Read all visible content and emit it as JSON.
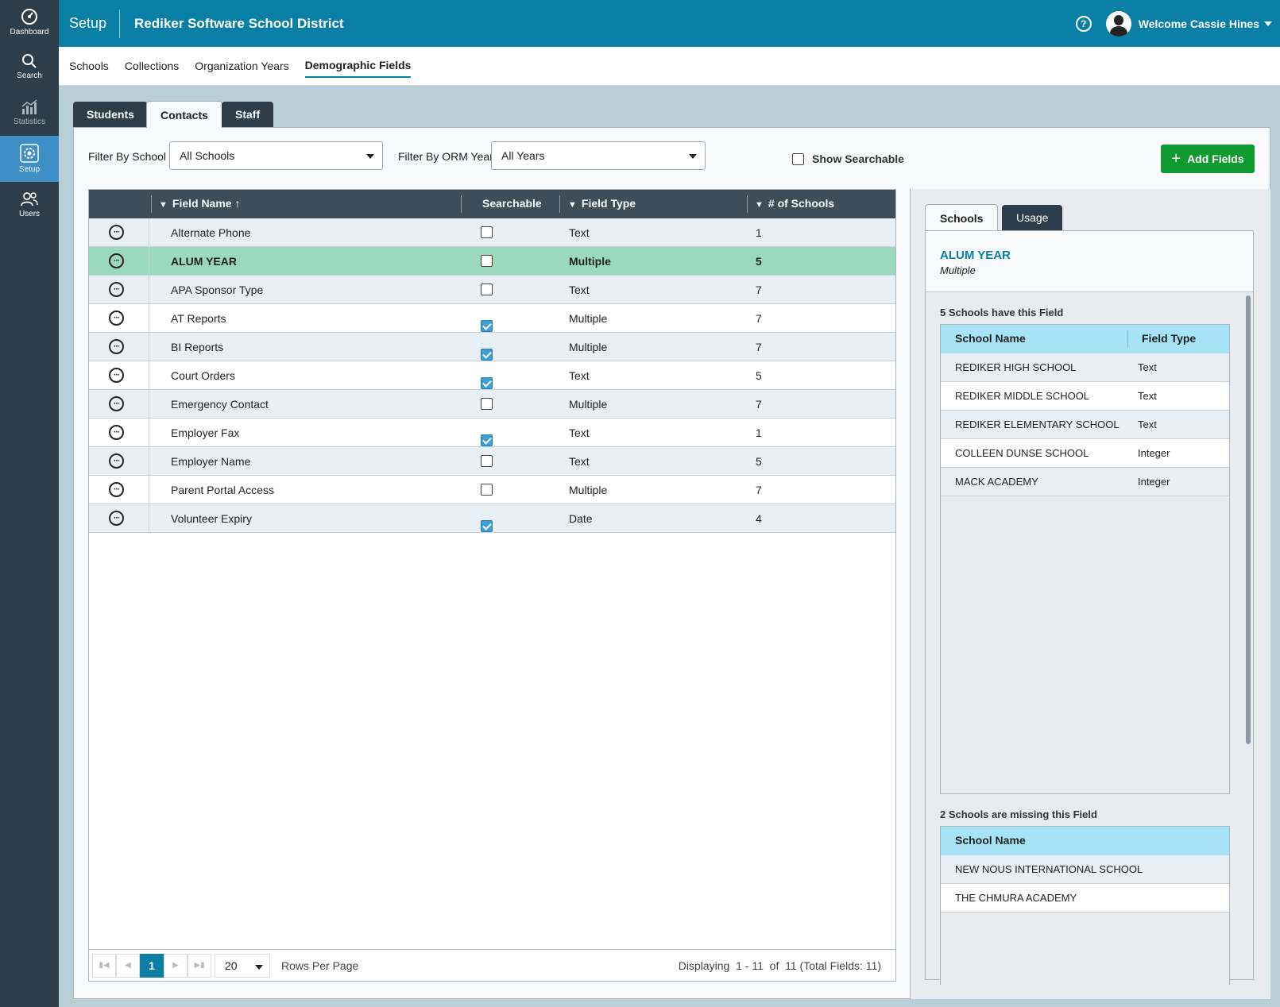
{
  "sidebar": {
    "items": [
      {
        "label": "Dashboard",
        "icon": "dashboard-icon"
      },
      {
        "label": "Search",
        "icon": "search-icon"
      },
      {
        "label": "Statistics",
        "icon": "statistics-icon"
      },
      {
        "label": "Setup",
        "icon": "gear-icon"
      },
      {
        "label": "Users",
        "icon": "users-icon"
      }
    ]
  },
  "header": {
    "section": "Setup",
    "district": "Rediker Software School District",
    "help_icon": "?",
    "welcome": "Welcome Cassie Hines"
  },
  "subnav": [
    "Schools",
    "Collections",
    "Organization Years",
    "Demographic Fields"
  ],
  "tabs": [
    "Students",
    "Contacts",
    "Staff"
  ],
  "filters": {
    "school_label": "Filter By School",
    "school_value": "All Schools",
    "year_label": "Filter By ORM Year",
    "year_value": "All Years",
    "searchable_label": "Show Searchable",
    "add_button": "Add Fields"
  },
  "grid": {
    "columns": {
      "name": "Field Name",
      "searchable": "Searchable",
      "type": "Field Type",
      "count": "# of Schools"
    },
    "rows": [
      {
        "name": "Alternate Phone",
        "searchable": false,
        "type": "Text",
        "count": "1"
      },
      {
        "name": "ALUM YEAR",
        "searchable": false,
        "type": "Multiple",
        "count": "5"
      },
      {
        "name": "APA Sponsor Type",
        "searchable": false,
        "type": "Text",
        "count": "7"
      },
      {
        "name": "AT Reports",
        "searchable": true,
        "type": "Multiple",
        "count": "7"
      },
      {
        "name": "BI Reports",
        "searchable": true,
        "type": "Multiple",
        "count": "7"
      },
      {
        "name": "Court Orders",
        "searchable": true,
        "type": "Text",
        "count": "5"
      },
      {
        "name": "Emergency Contact",
        "searchable": false,
        "type": "Multiple",
        "count": "7"
      },
      {
        "name": "Employer Fax",
        "searchable": true,
        "type": "Text",
        "count": "1"
      },
      {
        "name": "Employer Name",
        "searchable": false,
        "type": "Text",
        "count": "5"
      },
      {
        "name": "Parent Portal Access",
        "searchable": false,
        "type": "Multiple",
        "count": "7"
      },
      {
        "name": "Volunteer Expiry",
        "searchable": true,
        "type": "Date",
        "count": "4"
      }
    ],
    "selected_row": 1
  },
  "pager": {
    "page": "1",
    "page_size": "20",
    "rows_per_page": "Rows Per Page",
    "display_prefix": "Displaying",
    "range": "1 - 11",
    "of_label": "of",
    "total": "11 (Total Fields: 11)"
  },
  "details": {
    "tabs": [
      "Schools",
      "Usage"
    ],
    "field_name": "ALUM YEAR",
    "field_type": "Multiple",
    "have_heading": "5 Schools have this Field",
    "have_columns": {
      "school": "School Name",
      "type": "Field Type"
    },
    "have_rows": [
      {
        "school": "REDIKER HIGH SCHOOL",
        "type": "Text"
      },
      {
        "school": "REDIKER MIDDLE SCHOOL",
        "type": "Text"
      },
      {
        "school": "REDIKER ELEMENTARY SCHOOL",
        "type": "Text"
      },
      {
        "school": "COLLEEN DUNSE SCHOOL",
        "type": "Integer"
      },
      {
        "school": "MACK ACADEMY",
        "type": "Integer"
      }
    ],
    "missing_heading": "2 Schools are missing this Field",
    "missing_column": "School Name",
    "missing_rows": [
      "NEW NOUS INTERNATIONAL SCHOOL",
      "THE CHMURA ACADEMY"
    ]
  }
}
